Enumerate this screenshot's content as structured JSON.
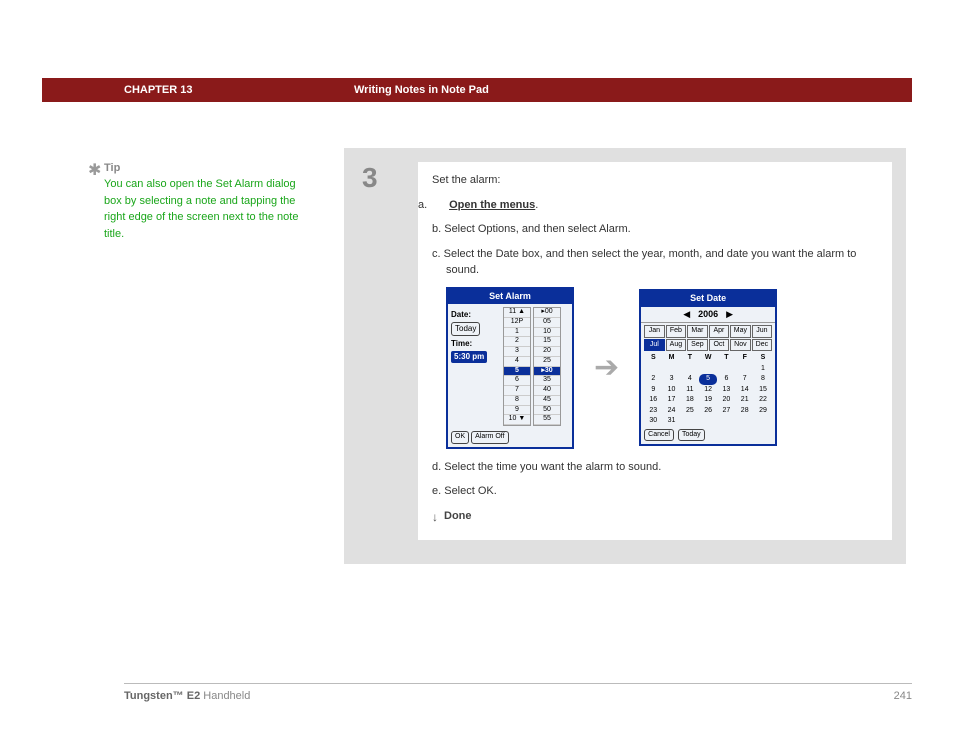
{
  "header": {
    "chapter": "CHAPTER 13",
    "section": "Writing Notes in Note Pad"
  },
  "tip": {
    "label": "Tip",
    "text": "You can also open the Set Alarm dialog box by selecting a note and tapping the right edge of the screen next to the note title."
  },
  "step": {
    "number": "3",
    "intro": "Set the alarm:",
    "a_letter": "a.",
    "a_text": "Open the menus",
    "a_period": ".",
    "b": "b.  Select Options, and then select Alarm.",
    "c": "c.  Select the Date box, and then select the year, month, and date you want the alarm to sound.",
    "d": "d.  Select the time you want the alarm to sound.",
    "e": "e.  Select OK.",
    "done": "Done"
  },
  "setAlarm": {
    "title": "Set Alarm",
    "dateLabel": "Date:",
    "dateValue": "Today",
    "timeLabel": "Time:",
    "timeValue": "5:30 pm",
    "hours": [
      "11 ▲",
      "12P",
      "1",
      "2",
      "3",
      "4",
      "5",
      "6",
      "7",
      "8",
      "9",
      "10 ▼"
    ],
    "selectedHour": "5",
    "mins": [
      "▸00",
      "05",
      "10",
      "15",
      "20",
      "25",
      "▸30",
      "35",
      "40",
      "45",
      "50",
      "55"
    ],
    "selectedMin": "▸30",
    "ok": "OK",
    "alarmOff": "Alarm Off"
  },
  "setDate": {
    "title": "Set Date",
    "yearPrev": "◀",
    "year": "2006",
    "yearNext": "▶",
    "months": [
      "Jan",
      "Feb",
      "Mar",
      "Apr",
      "May",
      "Jun",
      "Jul",
      "Aug",
      "Sep",
      "Oct",
      "Nov",
      "Dec"
    ],
    "selectedMonth": "Jul",
    "dow": [
      "S",
      "M",
      "T",
      "W",
      "T",
      "F",
      "S"
    ],
    "days": [
      "",
      "",
      "",
      "",
      "",
      "",
      "1",
      "2",
      "3",
      "4",
      "5",
      "6",
      "7",
      "8",
      "9",
      "10",
      "11",
      "12",
      "13",
      "14",
      "15",
      "16",
      "17",
      "18",
      "19",
      "20",
      "21",
      "22",
      "23",
      "24",
      "25",
      "26",
      "27",
      "28",
      "29",
      "30",
      "31",
      "",
      "",
      "",
      "",
      ""
    ],
    "selectedDay": "5",
    "cancel": "Cancel",
    "today": "Today"
  },
  "footer": {
    "product_bold": "Tungsten™ E2",
    "product_rest": " Handheld",
    "page": "241"
  }
}
